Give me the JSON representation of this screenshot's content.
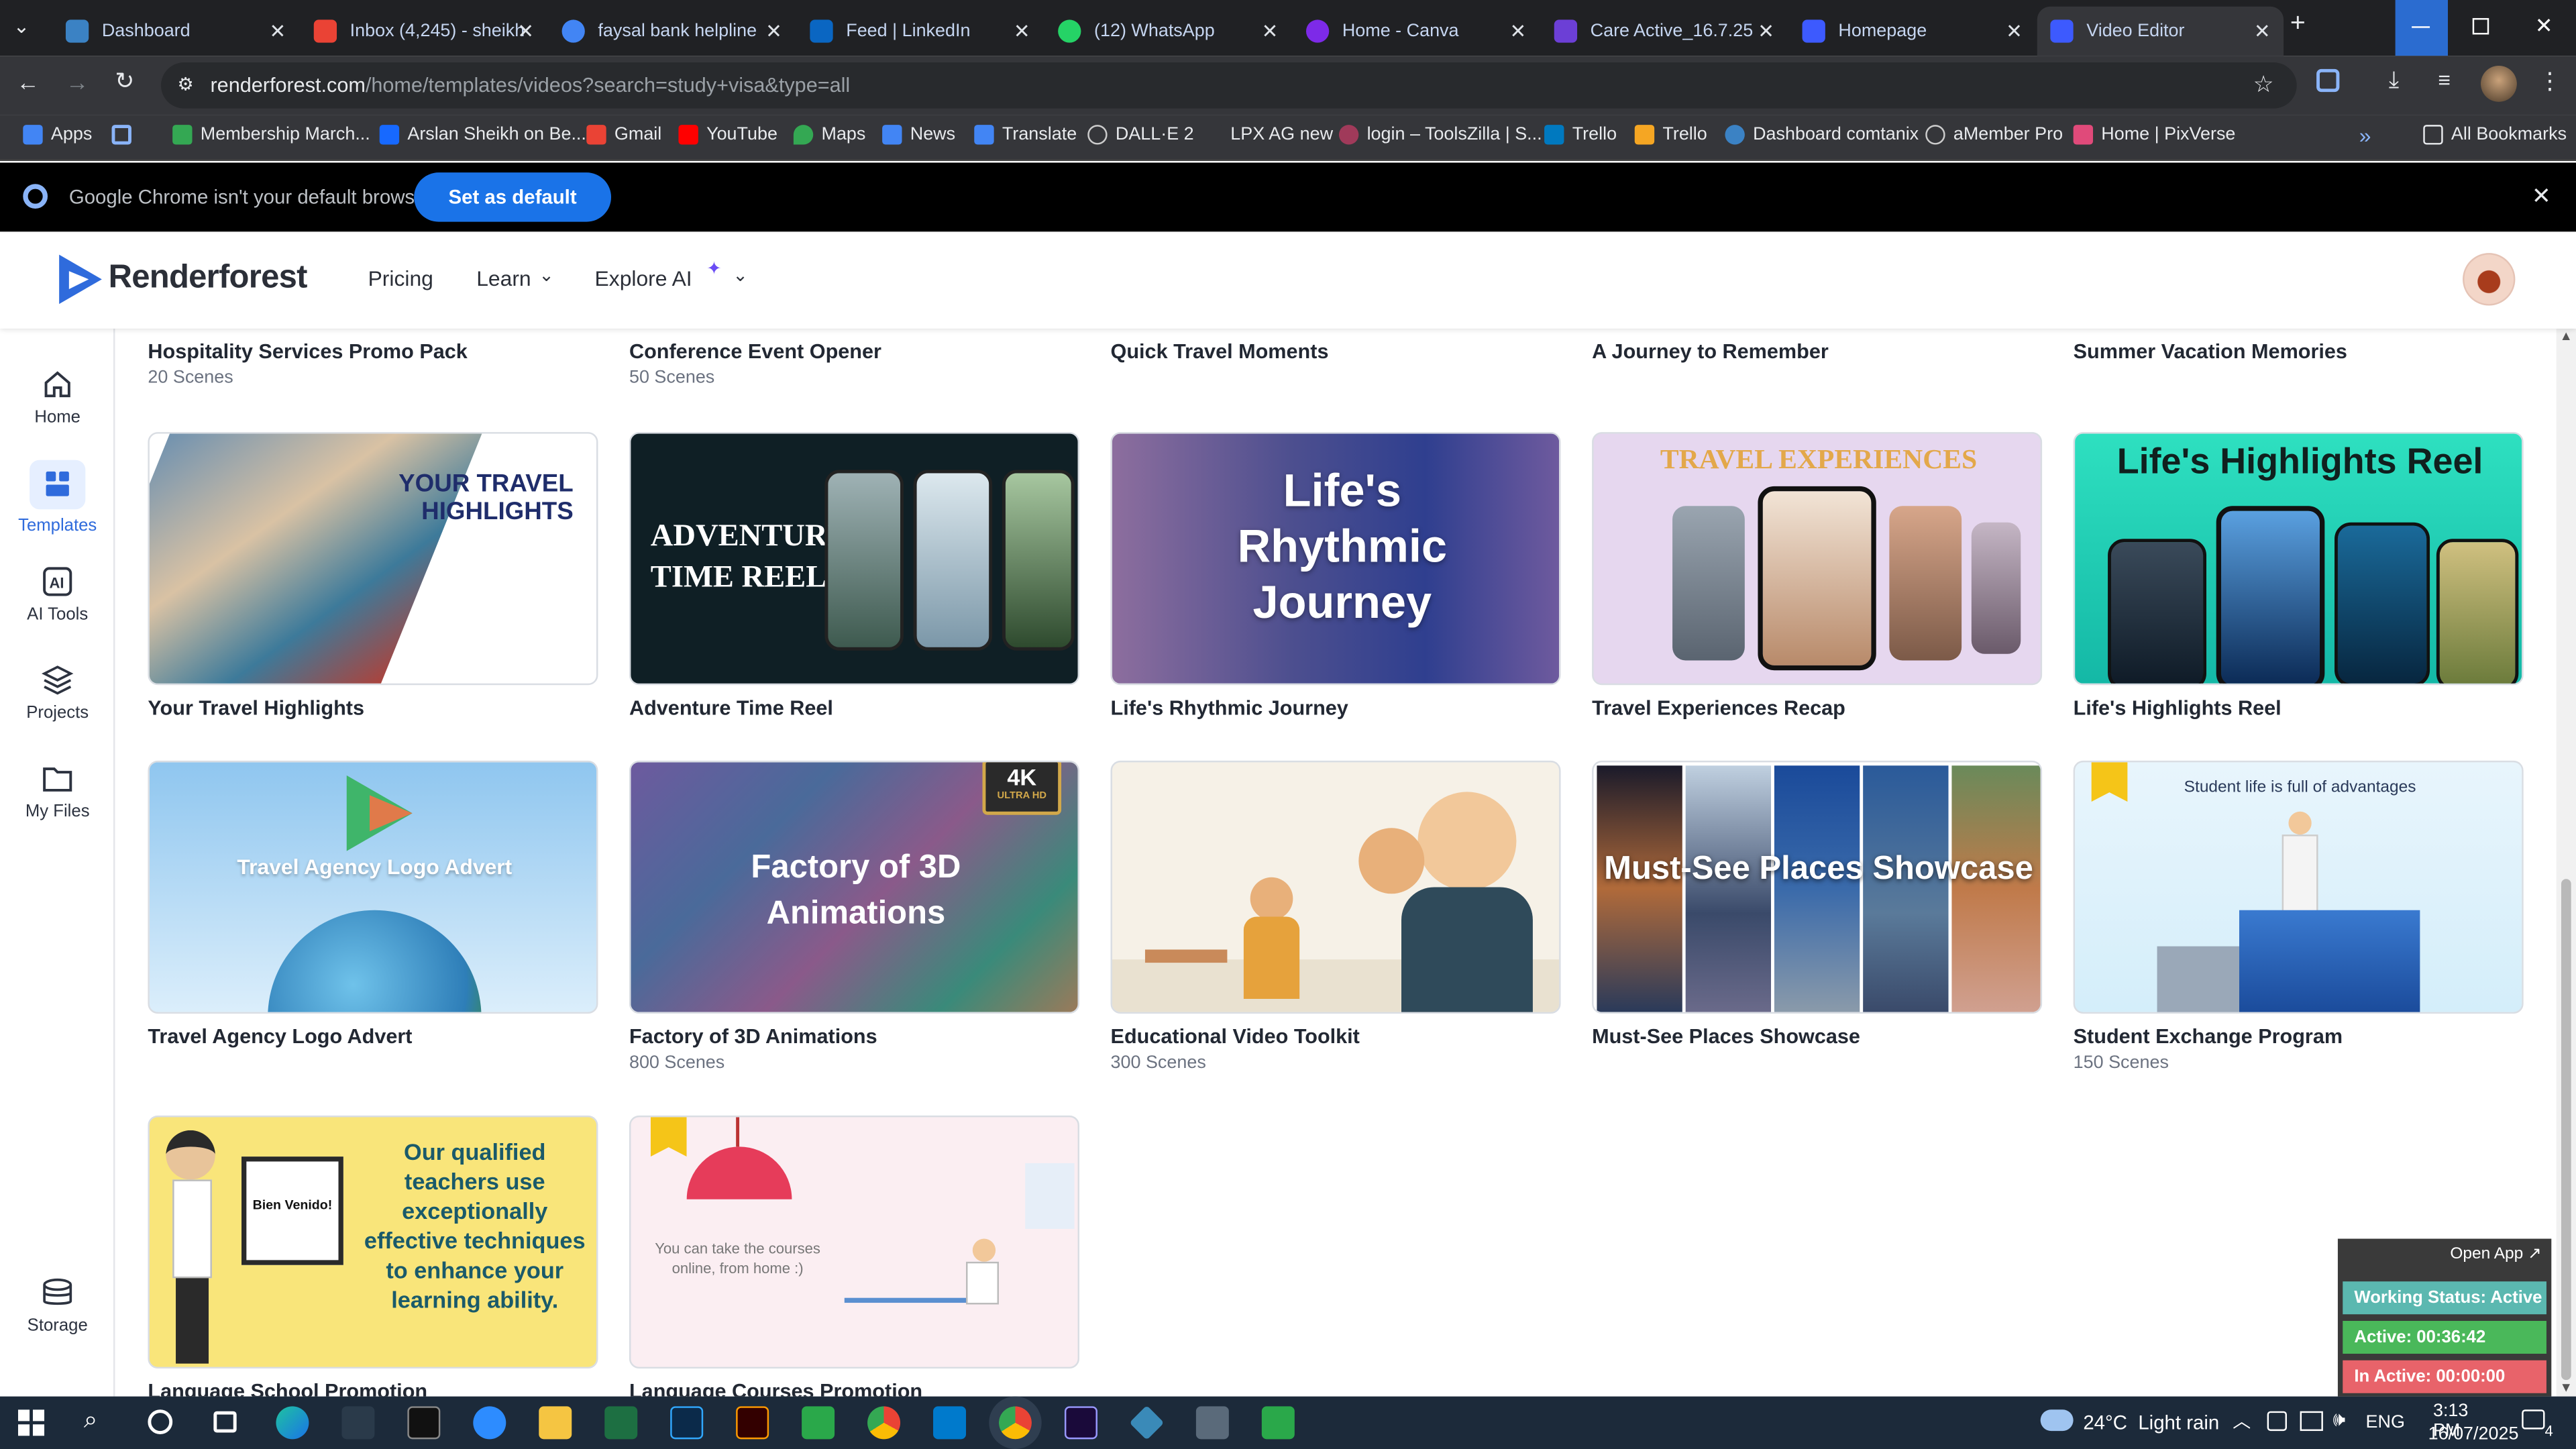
{
  "browser": {
    "tabs": [
      {
        "title": "Dashboard",
        "color": "#3b82c4"
      },
      {
        "title": "Inbox (4,245) - sheikh",
        "color": "#ea4335"
      },
      {
        "title": "faysal bank helpline",
        "color": "#4285f4"
      },
      {
        "title": "Feed | LinkedIn",
        "color": "#0a66c2"
      },
      {
        "title": "(12) WhatsApp",
        "color": "#25d366"
      },
      {
        "title": "Home - Canva",
        "color": "#7d2ae8"
      },
      {
        "title": "Care Active_16.7.25",
        "color": "#6c3fd6"
      },
      {
        "title": "Homepage",
        "color": "#3d5afe"
      },
      {
        "title": "Video Editor",
        "color": "#3d5afe"
      }
    ],
    "url_host": "renderforest.com",
    "url_path": "/home/templates/videos?search=study+visa&type=all",
    "bookmarks": [
      {
        "label": "Apps",
        "color": "#4285f4"
      },
      {
        "label": "",
        "color": "#8ab4f8"
      },
      {
        "label": "Membership March...",
        "color": "#34a853"
      },
      {
        "label": "Arslan Sheikh on Be...",
        "color": "#1769ff"
      },
      {
        "label": "Gmail",
        "color": "#ea4335"
      },
      {
        "label": "YouTube",
        "color": "#ff0000"
      },
      {
        "label": "Maps",
        "color": "#34a853"
      },
      {
        "label": "News",
        "color": "#4285f4"
      },
      {
        "label": "Translate",
        "color": "#4285f4"
      },
      {
        "label": "DALL·E 2",
        "color": "#cccccc"
      },
      {
        "label": "LPX AG new",
        "color": "#35363a"
      },
      {
        "label": "login – ToolsZilla | S...",
        "color": "#a03a5a"
      },
      {
        "label": "Trello",
        "color": "#0079bf"
      },
      {
        "label": "Trello",
        "color": "#f5a623"
      },
      {
        "label": "Dashboard comtanix",
        "color": "#3b82c4"
      },
      {
        "label": "aMember Pro",
        "color": "#cccccc"
      },
      {
        "label": "Home | PixVerse",
        "color": "#e04a7a"
      }
    ],
    "all_bookmarks": "All Bookmarks",
    "infobar_msg": "Google Chrome isn't your default browser",
    "infobar_btn": "Set as default"
  },
  "site": {
    "logo": "Renderforest",
    "nav": [
      "Pricing",
      "Learn",
      "Explore AI"
    ],
    "sidebar": [
      "Home",
      "Templates",
      "AI Tools",
      "Projects",
      "My Files",
      "Storage"
    ]
  },
  "cards_top": [
    {
      "title": "Hospitality Services Promo Pack",
      "scenes": "20 Scenes"
    },
    {
      "title": "Conference Event Opener",
      "scenes": "50 Scenes"
    },
    {
      "title": "Quick Travel Moments",
      "scenes": ""
    },
    {
      "title": "A Journey to Remember",
      "scenes": ""
    },
    {
      "title": "Summer Vacation Memories",
      "scenes": ""
    }
  ],
  "cards_row1": [
    {
      "title": "Your Travel Highlights",
      "scenes": "",
      "thumb_text": "YOUR TRAVEL HIGHLIGHTS"
    },
    {
      "title": "Adventure Time Reel",
      "scenes": "",
      "thumb_text": "ADVENTURE TIME REEL"
    },
    {
      "title": "Life's Rhythmic Journey",
      "scenes": "",
      "thumb_text": "Life's Rhythmic Journey"
    },
    {
      "title": "Travel Experiences Recap",
      "scenes": "",
      "thumb_text": "TRAVEL EXPERIENCES"
    },
    {
      "title": "Life's Highlights Reel",
      "scenes": "",
      "thumb_text": "Life's Highlights Reel"
    }
  ],
  "cards_row2": [
    {
      "title": "Travel Agency Logo Advert",
      "scenes": "",
      "thumb_text": "Travel Agency Logo Advert"
    },
    {
      "title": "Factory of 3D Animations",
      "scenes": "800 Scenes",
      "thumb_text": "Factory of 3D Animations"
    },
    {
      "title": "Educational Video Toolkit",
      "scenes": "300 Scenes",
      "thumb_text": ""
    },
    {
      "title": "Must-See Places Showcase",
      "scenes": "",
      "thumb_text": "Must-See Places Showcase"
    },
    {
      "title": "Student Exchange Program",
      "scenes": "150 Scenes",
      "thumb_text": "Student life is full of advantages"
    }
  ],
  "cards_row3": [
    {
      "title": "Language School Promotion",
      "scenes": "",
      "thumb_text": "Our qualified teachers use exceptionally effective techniques to enhance your learning ability.",
      "sign": "Bien Venido!"
    },
    {
      "title": "Language Courses Promotion",
      "scenes": "",
      "thumb_text": "You can take the courses online, from home :)"
    }
  ],
  "badge_4k": {
    "big": "4K",
    "small": "ULTRA HD"
  },
  "widget": {
    "open": "Open App ↗",
    "status": "Working Status: Active",
    "active": "Active: 00:36:42",
    "inactive": "In Active: 00:00:00"
  },
  "taskbar": {
    "weather": "24°C  Light rain",
    "lang": "ENG",
    "time": "3:13 PM",
    "date": "16/07/2025",
    "notif": "4"
  }
}
